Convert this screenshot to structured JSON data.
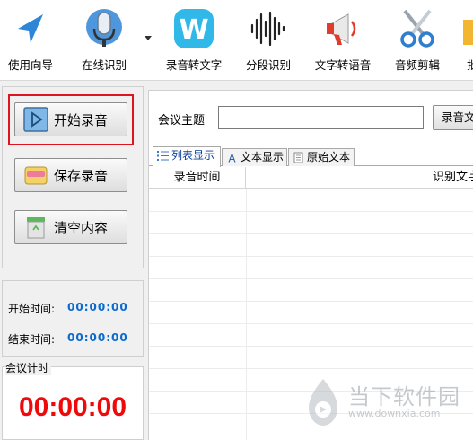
{
  "toolbar": {
    "items": [
      {
        "label": "使用向导",
        "icon": "navigate-arrow-icon"
      },
      {
        "label": "在线识别",
        "icon": "microphone-icon"
      },
      {
        "label": "录音转文字",
        "icon": "w-logo-icon"
      },
      {
        "label": "分段识别",
        "icon": "waveform-icon"
      },
      {
        "label": "文字转语音",
        "icon": "megaphone-icon"
      },
      {
        "label": "音频剪辑",
        "icon": "scissors-icon"
      },
      {
        "label": "批",
        "icon": "folder-icon"
      }
    ]
  },
  "controls": {
    "start_label": "开始录音",
    "save_label": "保存录音",
    "clear_label": "清空内容"
  },
  "times": {
    "start_label": "开始时间:",
    "start_value": "00:00:00",
    "end_label": "结束时间:",
    "end_value": "00:00:00"
  },
  "timer": {
    "group_label": "会议计时",
    "value": "00:00:00"
  },
  "meeting": {
    "topic_label": "会议主题",
    "topic_value": "",
    "record_button_label": "录音文"
  },
  "tabs": [
    {
      "label": "列表显示",
      "icon": "list-icon",
      "active": true
    },
    {
      "label": "文本显示",
      "icon": "text-a-icon",
      "active": false
    },
    {
      "label": "原始文本",
      "icon": "document-icon",
      "active": false
    }
  ],
  "table": {
    "columns": [
      "录音时间",
      "识别文字"
    ]
  },
  "watermark": {
    "title": "当下软件园",
    "url": "www.downxia.com"
  },
  "colors": {
    "timer_red": "#ee0a0a",
    "time_blue": "#0a6ad0",
    "highlight_red": "#e0141e"
  }
}
